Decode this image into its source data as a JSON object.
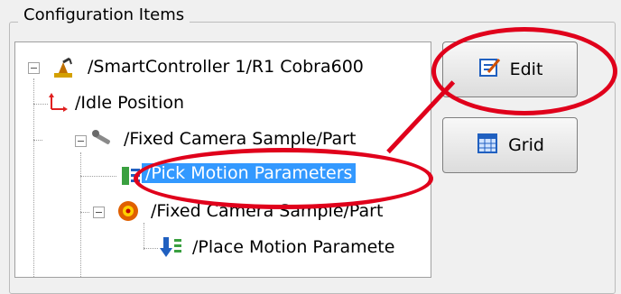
{
  "panel": {
    "title": "Configuration Items"
  },
  "tree": {
    "items": [
      {
        "label": "/SmartController 1/R1 Cobra600",
        "icon": "robot-arm-icon"
      },
      {
        "label": "/Idle Position",
        "icon": "axis-icon"
      },
      {
        "label": "/Fixed Camera Sample/Part",
        "icon": "wrench-icon"
      },
      {
        "label": "/Pick Motion Parameters",
        "icon": "motion-params-icon"
      },
      {
        "label": "/Fixed Camera Sample/Part",
        "icon": "target-icon"
      },
      {
        "label": "/Place Motion Paramete",
        "icon": "place-motion-icon"
      }
    ]
  },
  "buttons": {
    "edit": "Edit",
    "grid": "Grid"
  },
  "colors": {
    "highlight": "#e0001b",
    "selection": "#3399ff"
  }
}
